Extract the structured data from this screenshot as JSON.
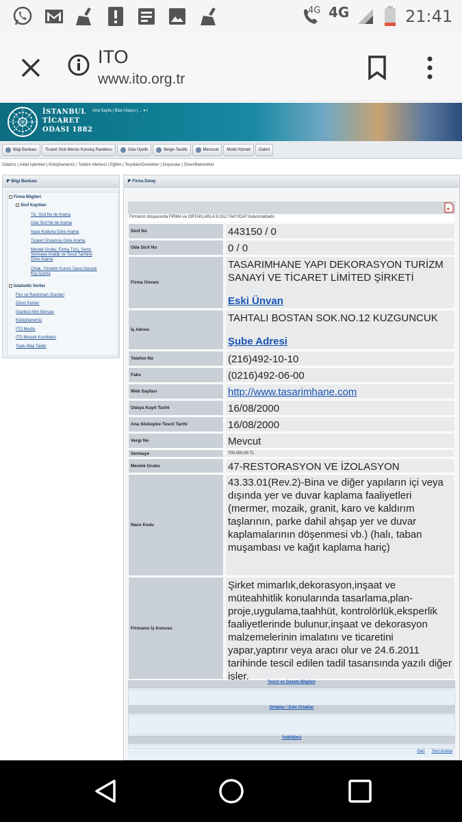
{
  "status_bar": {
    "network_left": "4G",
    "network_right": "4G",
    "time": "21:41"
  },
  "browser": {
    "title": "ITO",
    "url": "www.ito.org.tr"
  },
  "site": {
    "logo_lines": [
      "İSTANBUL",
      "TİCARET",
      "ODASI 1882"
    ],
    "top_links": "Ana Sayfa | Bize Ulaşın | ... ▾ |",
    "nav_buttons": [
      "Bilgi Bankası",
      "Ticaret Sicil-Mersis Kuruluş Randevu",
      "Oda Üyelik",
      "Belge-Tasdik",
      "Mevzuat",
      "Mobil Hizmet",
      "Galeri"
    ],
    "sub_links": "Odamız | Aidat İşlemleri | Kütüphanemiz | Tahkim Merkezi | Eğitim | Teşvikler/Destekler | Duyurular | Öneri/Beklentiler"
  },
  "left_panel": {
    "title": "Bilgi Bankası",
    "tree": {
      "firma_bilgileri": "Firma Bilgileri",
      "sicil_kayitlari": "Sicil Kayıtları",
      "tic_sicil": "Tic. Sicil No ile Arama",
      "oda_sicil": "Oda Sicil No ile Arama",
      "nace": "Nace Koduna Göre Arama",
      "unvan": "Ticaret Ünvanına Göre Arama",
      "meslek_1": "Meslek Grubu, Firma Türü, Semt,",
      "meslek_2": "Sermaye Aralığı ve Tescil Tarihine",
      "meslek_3": "Göre Arama",
      "ortak_1": "Ortak, Yönetim Kurulu Üyesi,Gerçek",
      "ortak_2": "Kişi Arama",
      "istatistik": "İstatistiki Veriler",
      "fire": "Fire ve Randıman Oranları",
      "doviz": "Döviz Kurları",
      "altin": "İstanbul Altın Borsası",
      "kutuphane": "Kütüphanemiz",
      "meclis": "ITO Meclis",
      "komite": "ITO Meslek Komiteleri",
      "toplu": "Toplu Bilgi Talebi"
    }
  },
  "detail": {
    "panel_title": "Firma Detay",
    "notice": "Firmanın dosyasında FIRMA ve ORTAKLARLA İLGİLİ TAKYİDAT bulunmaktadır.",
    "rows": {
      "sicil_no": {
        "label": "Sicil No",
        "value": "443150 / 0"
      },
      "oda_sicil_no": {
        "label": "Oda Sicil No",
        "value": "0 / 0"
      },
      "unvan": {
        "label": "Firma Ünvanı",
        "value_1": "TASARIMHANE YAPI DEKORASYON TURİZM",
        "value_2": "SANAYİ VE TİCARET LİMİTED ŞİRKETİ",
        "link": "Eski Ünvan"
      },
      "adres": {
        "label": "İş Adresi",
        "value": "TAHTALI BOSTAN SOK.NO.12 KUZGUNCUK",
        "link": "Şube Adresi"
      },
      "telefon": {
        "label": "Telefon No",
        "value": "(216)492-10-10"
      },
      "faks": {
        "label": "Faks",
        "value": "(0216)492-06-00"
      },
      "web": {
        "label": "Web Sayfası",
        "value": "http://www.tasarimhane.com"
      },
      "kayit": {
        "label": "Odaya Kayıt Tarihi",
        "value": "16/08/2000"
      },
      "tescil": {
        "label": "Ana Sözleşme Tescil Tarihi",
        "value": "16/08/2000"
      },
      "vergi": {
        "label": "Vergi No",
        "value": "Mevcut"
      },
      "sermaye": {
        "label": "Sermaye",
        "value": "700.000,00 TL"
      },
      "meslek": {
        "label": "Meslek Grubu",
        "value": "47-RESTORASYON VE İZOLASYON"
      },
      "nace": {
        "label": "Nace Kodu",
        "value": "43.33.01(Rev.2)-Bina ve diğer yapıların içi veya dışında yer ve duvar kaplama faaliyetleri (mermer, mozaik, granit, karo ve kaldırım taşlarının, parke dahil ahşap yer ve duvar kaplamalarının döşenmesi vb.) (halı, taban muşambası ve kağıt kaplama hariç)"
      },
      "konu": {
        "label": "Firmanın İş Konusu",
        "value": "Şirket mimarlık,dekorasyon,inşaat ve müteahhitlik konularında tasarlama,plan-proje,uygulama,taahhüt, kontrolörlük,eksperlik faaliyetlerinde bulunur,inşaat ve dekorasyon malzemelerinin imalatını ve ticaretini yapar,yaptırır veya aracı olur ve 24.6.2011 tarihinde tescil edilen tadil tasarısında yazılı diğer işler."
      }
    },
    "sections": {
      "tescil_gazete": "Tescil ve Gazete Bilgileri",
      "ortaklar": "Ortaklar / Eski Ortaklar",
      "yetkililer": "Yetkili(ler)"
    },
    "bottom": {
      "geri": "Geri",
      "yeni": "Yeni Arama"
    }
  }
}
